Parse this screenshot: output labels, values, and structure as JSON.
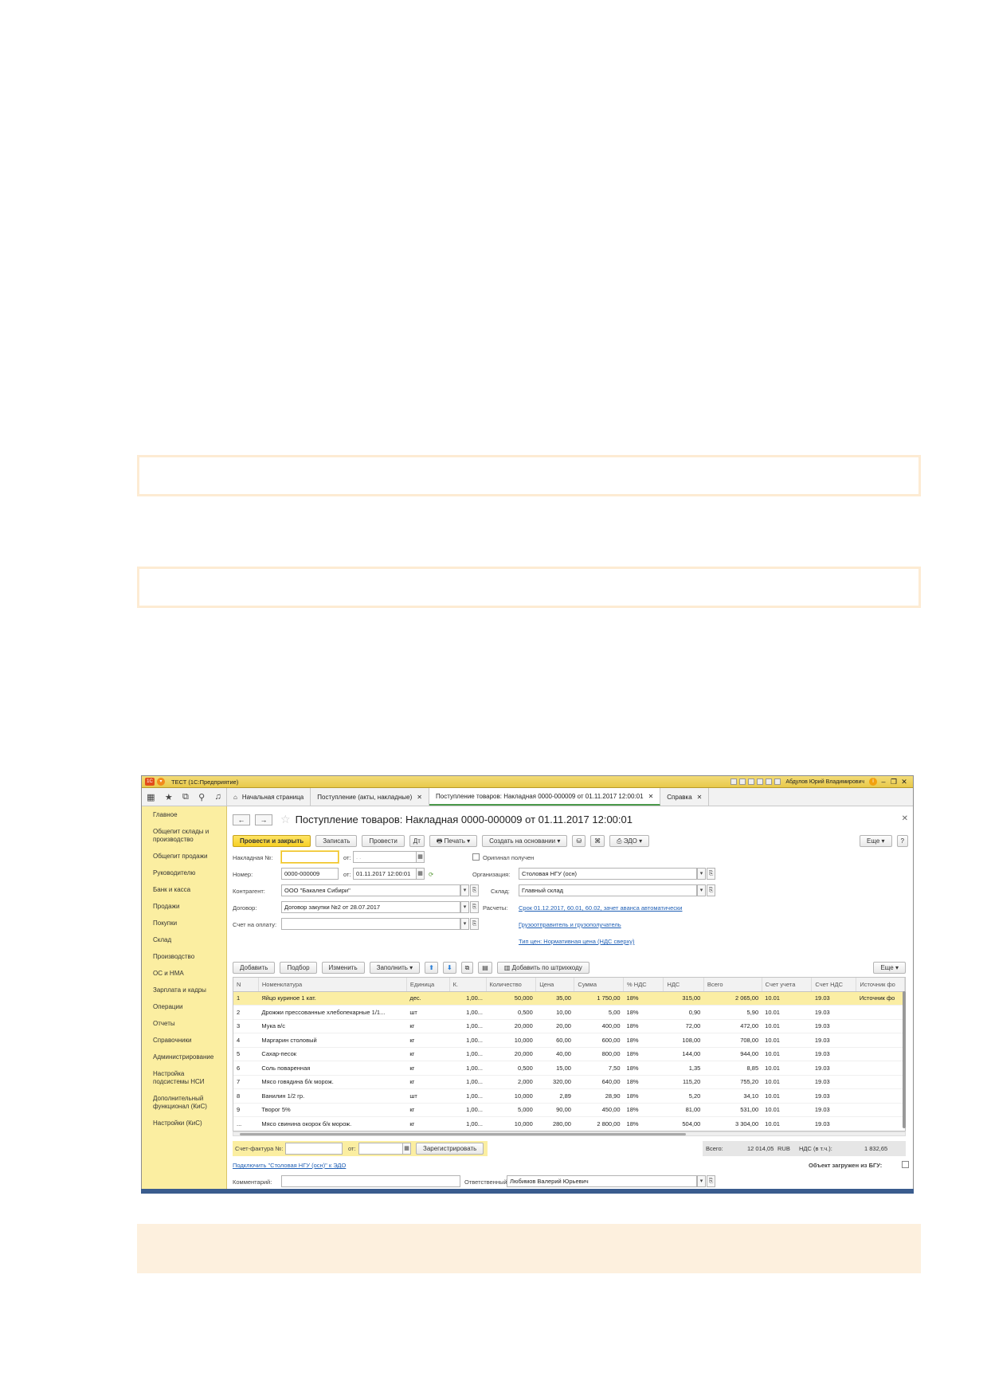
{
  "app": {
    "title": "ТЕСТ (1С:Предприятие)",
    "logo": "1С",
    "user": "Абдулов Юрий Владимирович"
  },
  "tabs": [
    {
      "label": "Начальная страница"
    },
    {
      "label": "Поступление (акты, накладные)"
    },
    {
      "label": "Поступление товаров: Накладная 0000-000009 от 01.11.2017 12:00:01"
    },
    {
      "label": "Справка"
    }
  ],
  "sidebar": {
    "items": [
      "Главное",
      "Общепит склады и производство",
      "Общепит продажи",
      "Руководителю",
      "Банк и касса",
      "Продажи",
      "Покупки",
      "Склад",
      "Производство",
      "ОС и НМА",
      "Зарплата и кадры",
      "Операции",
      "Отчеты",
      "Справочники",
      "Администрирование",
      "Настройка подсистемы НСИ",
      "Дополнительный функционал (КиС)",
      "Настройки (КиС)"
    ]
  },
  "document": {
    "title": "Поступление товаров: Накладная 0000-000009 от 01.11.2017 12:00:01"
  },
  "toolbar": {
    "post_close": "Провести и закрыть",
    "save": "Записать",
    "post": "Провести",
    "print": "Печать",
    "create_based": "Создать на основании",
    "edo": "ЭДО",
    "more": "Еще",
    "help": "?"
  },
  "form": {
    "invoice_no_label": "Накладная №:",
    "invoice_no_value": "",
    "from_label": "от:",
    "invoice_date_placeholder": " .  .    ",
    "original_label": "Оригинал получен",
    "number_label": "Номер:",
    "number_value": "0000-000009",
    "date_value": "01.11.2017 12:00:01",
    "org_label": "Организация:",
    "org_value": "Столовая НГУ (осн)",
    "contractor_label": "Контрагент:",
    "contractor_value": "ООО \"Бакалея Сибири\"",
    "warehouse_label": "Склад:",
    "warehouse_value": "Главный склад",
    "contract_label": "Договор:",
    "contract_value": "Договор закупки №2 от 28.07.2017",
    "settlements_label": "Расчеты:",
    "settlements_link": "Срок 01.12.2017, 60.01, 60.02, зачет аванса автоматически",
    "payment_label": "Счет на оплату:",
    "payment_value": "",
    "shipper_link": "Грузоотправитель и грузополучатель",
    "price_type_link": "Тип цен: Нормативная цена (НДС сверху)"
  },
  "table_toolbar": {
    "add": "Добавить",
    "pick": "Подбор",
    "change": "Изменить",
    "fill": "Заполнить",
    "barcode": "Добавить по штрихкоду",
    "more": "Еще"
  },
  "table": {
    "columns": [
      "N",
      "Номенклатура",
      "Единица",
      "К.",
      "Количество",
      "Цена",
      "Сумма",
      "% НДС",
      "НДС",
      "Всего",
      "Счет учета",
      "Счет НДС",
      "Источник фо"
    ],
    "rows": [
      [
        "1",
        "Яйцо куриное 1 кат.",
        "дес.",
        "1,00...",
        "50,000",
        "35,00",
        "1 750,00",
        "18%",
        "315,00",
        "2 065,00",
        "10.01",
        "19.03",
        "Источник фо"
      ],
      [
        "2",
        "Дрожжи прессованные хлебопекарные 1/1...",
        "шт",
        "1,00...",
        "0,500",
        "10,00",
        "5,00",
        "18%",
        "0,90",
        "5,90",
        "10.01",
        "19.03",
        ""
      ],
      [
        "3",
        "Мука в/с",
        "кг",
        "1,00...",
        "20,000",
        "20,00",
        "400,00",
        "18%",
        "72,00",
        "472,00",
        "10.01",
        "19.03",
        ""
      ],
      [
        "4",
        "Маргарин столовый",
        "кг",
        "1,00...",
        "10,000",
        "60,00",
        "600,00",
        "18%",
        "108,00",
        "708,00",
        "10.01",
        "19.03",
        ""
      ],
      [
        "5",
        "Сахар-песок",
        "кг",
        "1,00...",
        "20,000",
        "40,00",
        "800,00",
        "18%",
        "144,00",
        "944,00",
        "10.01",
        "19.03",
        ""
      ],
      [
        "6",
        "Соль поваренная",
        "кг",
        "1,00...",
        "0,500",
        "15,00",
        "7,50",
        "18%",
        "1,35",
        "8,85",
        "10.01",
        "19.03",
        ""
      ],
      [
        "7",
        "Мясо говядина б/к морож.",
        "кг",
        "1,00...",
        "2,000",
        "320,00",
        "640,00",
        "18%",
        "115,20",
        "755,20",
        "10.01",
        "19.03",
        ""
      ],
      [
        "8",
        "Ванилин 1/2 гр.",
        "шт",
        "1,00...",
        "10,000",
        "2,89",
        "28,90",
        "18%",
        "5,20",
        "34,10",
        "10.01",
        "19.03",
        ""
      ],
      [
        "9",
        "Творог 5%",
        "кг",
        "1,00...",
        "5,000",
        "90,00",
        "450,00",
        "18%",
        "81,00",
        "531,00",
        "10.01",
        "19.03",
        ""
      ],
      [
        "...",
        "Мясо свинина окорок б/к морож.",
        "кг",
        "1,00...",
        "10,000",
        "280,00",
        "2 800,00",
        "18%",
        "504,00",
        "3 304,00",
        "10.01",
        "19.03",
        ""
      ]
    ]
  },
  "footer": {
    "invoice_label": "Счет-фактура №:",
    "invoice_from": "от:",
    "register": "Зарегистрировать",
    "total_label": "Всего:",
    "total_value": "12 014,05",
    "currency": "RUB",
    "vat_label": "НДС (в т.ч.):",
    "vat_value": "1 832,65",
    "edo_link": "Подключить \"Столовая НГУ (осн)\" к ЭДО",
    "bgu_label": "Объект загружен из БГУ:",
    "comment_label": "Комментарий:",
    "comment_value": "",
    "responsible_label": "Ответственный:",
    "responsible_value": "Любимов Валерий Юрьевич"
  },
  "colors": {
    "accent": "#f6cf24",
    "sidebar_bg": "#fbeea1",
    "note_border": "#fdebd3",
    "link": "#1f5fb5"
  }
}
